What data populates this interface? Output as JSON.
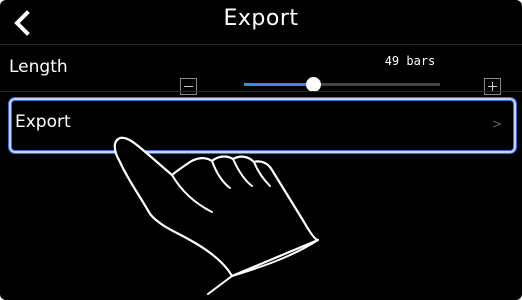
{
  "header": {
    "title": "Export",
    "back_icon": "chevron-left-icon"
  },
  "length_row": {
    "label": "Length",
    "value_text": "49 bars",
    "slider_fraction": 0.35,
    "minus_icon": "minus-box-icon",
    "plus_icon": "plus-box-icon"
  },
  "export_row": {
    "label": "Export",
    "chevron": ">"
  },
  "colors": {
    "background": "#000000",
    "text": "#ffffff",
    "accent": "#3d82f0",
    "selection_outline": "#3a6fd8"
  }
}
